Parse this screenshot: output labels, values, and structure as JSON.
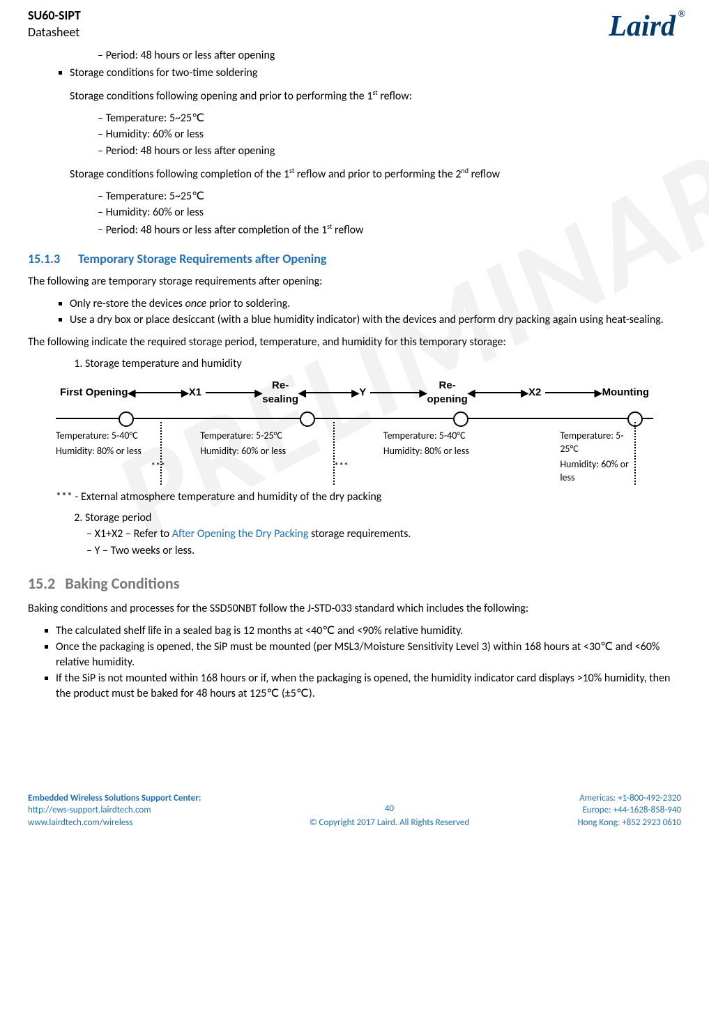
{
  "header": {
    "title": "SU60-SIPT",
    "subtitle": "Datasheet",
    "logo": "Laird"
  },
  "top_dash_item": "Period: 48 hours or less after opening",
  "sq1": "Storage conditions for two-time soldering",
  "p1_pre": "Storage conditions following opening and prior to performing the 1",
  "p1_sup": "st",
  "p1_post": " reflow:",
  "d1a": "Temperature: 5~25℃",
  "d1b": "Humidity: 60% or less",
  "d1c": "Period: 48 hours or less after opening",
  "p2_pre": "Storage conditions following completion of the 1",
  "p2_sup": "st",
  "p2_mid": " reflow and prior to performing the 2",
  "p2_sup2": "nd",
  "p2_post": " reflow",
  "d2a": "Temperature: 5~25℃",
  "d2b": "Humidity: 60% or less",
  "d2c_pre": "Period: 48 hours or less after completion of the 1",
  "d2c_sup": "st",
  "d2c_post": " reflow",
  "sec1513": {
    "num": "15.1.3",
    "title": "Temporary Storage Requirements after Opening"
  },
  "p3": "The following are temporary storage requirements after opening:",
  "sq2a_pre": "Only re-store the devices ",
  "sq2a_em": "once",
  "sq2a_post": " prior to soldering.",
  "sq2b": "Use a dry box or place desiccant (with a blue humidity indicator) with the devices and perform dry packing again using heat-sealing.",
  "p4": "The following indicate the required storage period, temperature, and humidity for this temporary storage:",
  "ol1": "Storage temperature and humidity",
  "diagram": {
    "labels": {
      "first": "First Opening",
      "x1": "X1",
      "reseal": "Re-\nsealing",
      "y": "Y",
      "reopen": "Re-\nopening",
      "x2": "X2",
      "mount": "Mounting"
    },
    "cols": [
      {
        "t": "Temperature: 5-40°C",
        "h": "Humidity: 80% or less",
        "star": "***"
      },
      {
        "t": "Temperature: 5-25°C",
        "h": "Humidity: 60% or less",
        "star": "***"
      },
      {
        "t": "Temperature: 5-40°C",
        "h": "Humidity: 80% or less",
        "star": ""
      },
      {
        "t": "Temperature: 5-25°C",
        "h": "Humidity: 60% or less",
        "star": ""
      }
    ]
  },
  "footnote": "*** - External atmosphere temperature and humidity of the dry packing",
  "ol2": "Storage period",
  "ol2a_pre": "X1+X2 – Refer to ",
  "ol2a_link": "After Opening the Dry Packing",
  "ol2a_post": " storage requirements.",
  "ol2b": "Y – Two weeks or less.",
  "sec152": {
    "num": "15.2",
    "title": "Baking Conditions"
  },
  "p5": "Baking conditions and processes for the SSD50NBT follow the J-STD-033 standard which includes the following:",
  "bk1": "The calculated shelf life in a sealed bag is 12 months at <40℃ and <90% relative humidity.",
  "bk2": "Once the packaging is opened, the SiP must be mounted (per MSL3/Moisture Sensitivity Level 3) within 168 hours at <30℃ and <60% relative humidity.",
  "bk3": "If the SiP is not mounted within 168 hours or if, when the packaging is opened, the humidity indicator card displays >10% humidity, then the product must be baked for 48 hours at 125℃ (±5℃).",
  "footer": {
    "l1": "Embedded Wireless Solutions Support Center:",
    "l2": "http://ews-support.lairdtech.com",
    "l3": "www.lairdtech.com/wireless",
    "pnum": "40",
    "copy": "© Copyright 2017 Laird. All Rights Reserved",
    "r1": "Americas: +1-800-492-2320",
    "r2": "Europe: +44-1628-858-940",
    "r3": "Hong Kong: +852 2923 0610"
  }
}
